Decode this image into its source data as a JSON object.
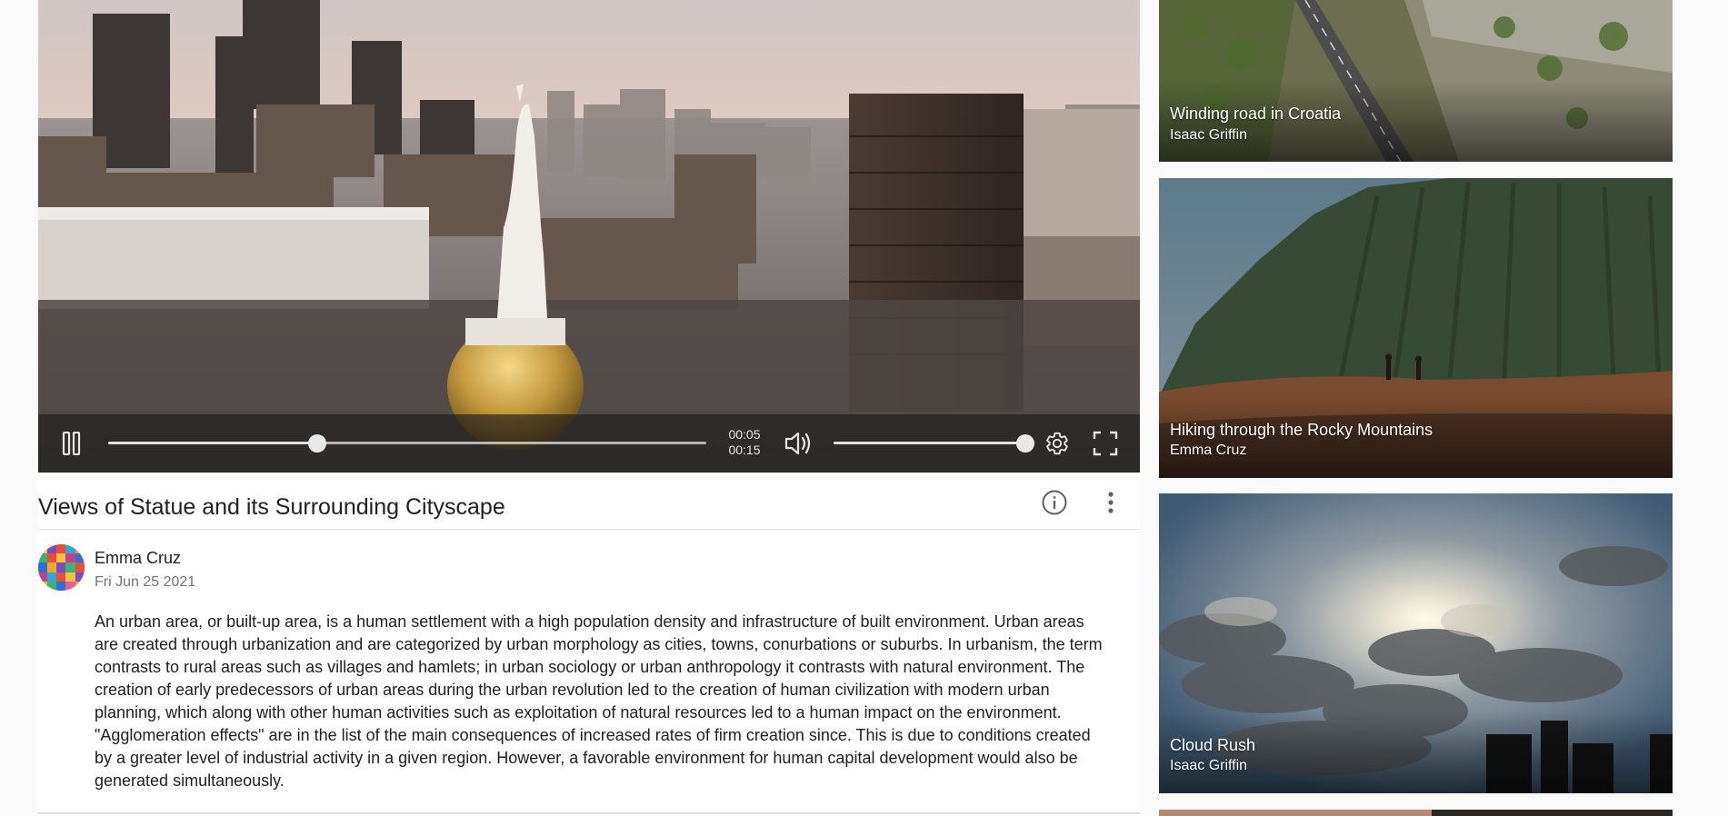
{
  "video": {
    "title": "Views of Statue and its Surrounding Cityscape",
    "progress": 0.35,
    "volume": 1.0,
    "time_elapsed": "00:05",
    "time_total": "00:15",
    "controls": {
      "play_state": "playing",
      "pause_icon": "pause-icon",
      "volume_icon": "volume-icon",
      "settings_icon": "gear-icon",
      "fullscreen_icon": "fullscreen-icon"
    }
  },
  "actions": {
    "info_icon": "info-icon",
    "more_icon": "more-vert-icon"
  },
  "author": {
    "name": "Emma Cruz",
    "date": "Fri Jun 25 2021"
  },
  "description": "An urban area, or built-up area, is a human settlement with a high population density and infrastructure of built environment. Urban areas are created through urbanization and are categorized by urban morphology as cities, towns, conurbations or suburbs. In urbanism, the term contrasts to rural areas such as villages and hamlets; in urban sociology or urban anthropology it contrasts with natural environment. The creation of early predecessors of urban areas during the urban revolution led to the creation of human civilization with modern urban planning, which along with other human activities such as exploitation of natural resources led to a human impact on the environment. \"Agglomeration effects\" are in the list of the main consequences of increased rates of firm creation since. This is due to conditions created by a greater level of industrial activity in a given region. However, a favorable environment for human capital development would also be generated simultaneously.",
  "related": [
    {
      "title": "Winding road in Croatia",
      "author": "Isaac Griffin"
    },
    {
      "title": "Hiking through the Rocky Mountains",
      "author": "Emma Cruz"
    },
    {
      "title": "Cloud Rush",
      "author": "Isaac Griffin"
    }
  ],
  "colors": {
    "page_bg": "#fafafa",
    "surface": "#ffffff",
    "text_primary": "#212121",
    "text_secondary": "#757575",
    "control_bar": "#191919"
  }
}
